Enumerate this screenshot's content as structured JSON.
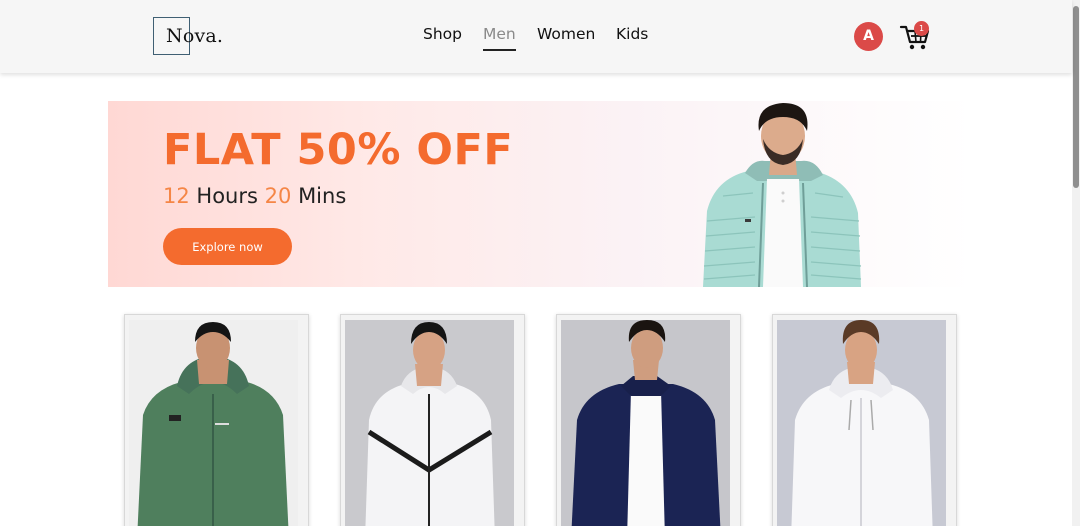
{
  "header": {
    "logo_text": "Nova.",
    "nav": [
      {
        "label": "Shop",
        "active": false
      },
      {
        "label": "Men",
        "active": true
      },
      {
        "label": "Women",
        "active": false
      },
      {
        "label": "Kids",
        "active": false
      }
    ],
    "avatar_initial": "A",
    "cart_icon": "shopping-cart-icon",
    "cart_count": "1"
  },
  "banner": {
    "headline": "FLAT 50% OFF",
    "timer": {
      "hours_value": "12",
      "hours_label": "Hours",
      "mins_value": "20",
      "mins_label": "Mins"
    },
    "button_label": "Explore now"
  },
  "products": [
    {
      "jacket_color": "#4f7f5d",
      "background": "#efefef"
    },
    {
      "jacket_color": "#f4f4f6",
      "background": "#c9c9cd"
    },
    {
      "jacket_color": "#1b2454",
      "background": "#c6c6cb"
    },
    {
      "jacket_color": "#f7f7f9",
      "background": "#c7c9d3"
    }
  ],
  "colors": {
    "accent": "#f46b2e",
    "avatar": "#db4a48",
    "header_bg": "#f6f6f6"
  }
}
